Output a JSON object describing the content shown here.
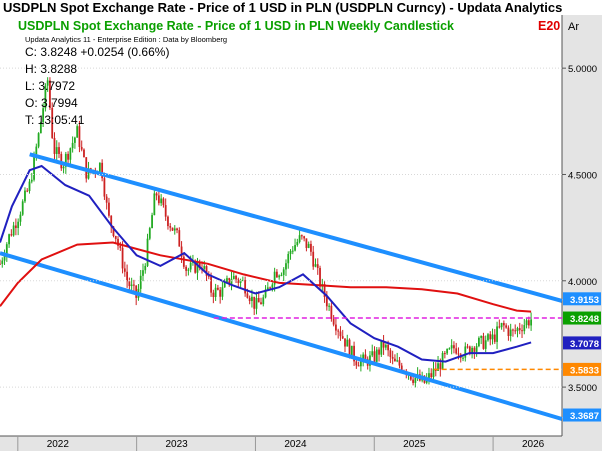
{
  "window": {
    "title": "USDPLN Spot Exchange Rate - Price of 1 USD in PLN (USDPLN Curncy) - Updata Analytics"
  },
  "header": {
    "chart_title": "USDPLN Spot Exchange Rate - Price of 1 USD in PLN Weekly Candlestick",
    "title_suffix": "E20",
    "axis_tag": "Ar",
    "source_line": "Updata Analytics 11 - Enterprise Edition : Data by Bloomberg"
  },
  "info_box": {
    "close": "C: 3.8248  +0.0254 (0.66%)",
    "high": "H: 3.8288",
    "low": "L: 3.7972",
    "open": "O: 3.7994",
    "time": "T: 13:05:41"
  },
  "colors": {
    "title_green": "#0aa000",
    "title_red": "#e00000",
    "channel_blue": "#1e8fff",
    "avg_red": "#e01010",
    "avg_navy": "#2020c0",
    "up_candle": "#22aa22",
    "down_candle": "#cc2222",
    "magenta_line": "#e020e0",
    "orange_line": "#ff8800",
    "axis_bg": "#e4e4e4"
  },
  "chart_data": {
    "type": "candlestick",
    "ylim": [
      3.27,
      5.25
    ],
    "x_range": [
      2021.85,
      2026.58
    ],
    "y_ticks": [
      "5.0000",
      "4.5000",
      "4.0000",
      "3.5000"
    ],
    "x_labels": [
      {
        "label": "2022",
        "x": 2022.0
      },
      {
        "label": "2023",
        "x": 2023.0
      },
      {
        "label": "2024",
        "x": 2024.0
      },
      {
        "label": "2025",
        "x": 2025.0
      },
      {
        "label": "2026",
        "x": 2026.0
      }
    ],
    "price_path": [
      [
        2021.85,
        4.08
      ],
      [
        2021.92,
        4.2
      ],
      [
        2022.0,
        4.3
      ],
      [
        2022.1,
        4.45
      ],
      [
        2022.18,
        4.7
      ],
      [
        2022.25,
        4.95
      ],
      [
        2022.3,
        4.62
      ],
      [
        2022.38,
        4.55
      ],
      [
        2022.5,
        4.7
      ],
      [
        2022.58,
        4.5
      ],
      [
        2022.7,
        4.55
      ],
      [
        2022.76,
        4.3
      ],
      [
        2022.82,
        4.22
      ],
      [
        2022.92,
        4.0
      ],
      [
        2023.0,
        3.92
      ],
      [
        2023.08,
        4.12
      ],
      [
        2023.16,
        4.42
      ],
      [
        2023.25,
        4.3
      ],
      [
        2023.35,
        4.2
      ],
      [
        2023.42,
        4.05
      ],
      [
        2023.55,
        4.08
      ],
      [
        2023.63,
        3.95
      ],
      [
        2023.72,
        3.95
      ],
      [
        2023.8,
        4.02
      ],
      [
        2023.9,
        3.99
      ],
      [
        2024.0,
        3.88
      ],
      [
        2024.08,
        3.92
      ],
      [
        2024.16,
        4.04
      ],
      [
        2024.24,
        4.06
      ],
      [
        2024.3,
        4.15
      ],
      [
        2024.38,
        4.2
      ],
      [
        2024.46,
        4.15
      ],
      [
        2024.56,
        3.96
      ],
      [
        2024.66,
        3.82
      ],
      [
        2024.74,
        3.73
      ],
      [
        2024.84,
        3.63
      ],
      [
        2024.92,
        3.62
      ],
      [
        2025.0,
        3.64
      ],
      [
        2025.08,
        3.7
      ],
      [
        2025.16,
        3.61
      ],
      [
        2025.24,
        3.6
      ],
      [
        2025.32,
        3.55
      ],
      [
        2025.42,
        3.52
      ],
      [
        2025.5,
        3.57
      ],
      [
        2025.58,
        3.63
      ],
      [
        2025.68,
        3.69
      ],
      [
        2025.76,
        3.66
      ],
      [
        2025.84,
        3.7
      ],
      [
        2025.92,
        3.71
      ],
      [
        2026.0,
        3.73
      ],
      [
        2026.08,
        3.79
      ],
      [
        2026.16,
        3.75
      ],
      [
        2026.24,
        3.79
      ],
      [
        2026.32,
        3.82
      ]
    ],
    "series": [
      {
        "name": "",
        "kind": "avg_red",
        "points": [
          [
            2021.85,
            3.88
          ],
          [
            2022.0,
            3.99
          ],
          [
            2022.2,
            4.1
          ],
          [
            2022.5,
            4.17
          ],
          [
            2022.8,
            4.18
          ],
          [
            2023.2,
            4.12
          ],
          [
            2023.6,
            4.08
          ],
          [
            2023.9,
            4.03
          ],
          [
            2024.2,
            3.99
          ],
          [
            2024.5,
            3.98
          ],
          [
            2024.8,
            3.97
          ],
          [
            2025.1,
            3.97
          ],
          [
            2025.4,
            3.96
          ],
          [
            2025.7,
            3.94
          ],
          [
            2026.0,
            3.89
          ],
          [
            2026.2,
            3.86
          ],
          [
            2026.32,
            3.855
          ]
        ]
      },
      {
        "name": "",
        "kind": "avg_navy",
        "points": [
          [
            2021.85,
            4.18
          ],
          [
            2021.95,
            4.35
          ],
          [
            2022.1,
            4.52
          ],
          [
            2022.2,
            4.54
          ],
          [
            2022.4,
            4.45
          ],
          [
            2022.6,
            4.4
          ],
          [
            2022.8,
            4.25
          ],
          [
            2023.0,
            4.12
          ],
          [
            2023.2,
            4.07
          ],
          [
            2023.4,
            4.13
          ],
          [
            2023.6,
            4.03
          ],
          [
            2023.8,
            3.98
          ],
          [
            2024.0,
            3.94
          ],
          [
            2024.2,
            3.97
          ],
          [
            2024.4,
            4.03
          ],
          [
            2024.6,
            3.93
          ],
          [
            2024.8,
            3.8
          ],
          [
            2025.0,
            3.73
          ],
          [
            2025.2,
            3.69
          ],
          [
            2025.4,
            3.63
          ],
          [
            2025.6,
            3.62
          ],
          [
            2025.8,
            3.66
          ],
          [
            2026.0,
            3.66
          ],
          [
            2026.2,
            3.69
          ],
          [
            2026.32,
            3.71
          ]
        ]
      }
    ],
    "channel_lines": [
      {
        "name": "",
        "from": [
          2022.1,
          4.595
        ],
        "to": [
          2026.58,
          3.905
        ]
      },
      {
        "name": "",
        "from": [
          2021.85,
          4.13
        ],
        "to": [
          2026.58,
          3.35
        ]
      }
    ],
    "hlines": [
      {
        "kind": "magenta_line",
        "y": 3.8248,
        "x_from": 2023.65
      },
      {
        "kind": "orange_line",
        "y": 3.5833,
        "x_from": 2025.5
      }
    ],
    "price_labels": [
      {
        "text": "3.9153",
        "y": 3.9153,
        "bg": "#1e8fff",
        "fg": "#ffffff"
      },
      {
        "text": "3.8248",
        "y": 3.8248,
        "bg": "#0aa000",
        "fg": "#ffffff"
      },
      {
        "text": "3.7078",
        "y": 3.7078,
        "bg": "#2020c0",
        "fg": "#ffffff"
      },
      {
        "text": "3.5833",
        "y": 3.5833,
        "bg": "#ff8800",
        "fg": "#ffffff"
      },
      {
        "text": "3.3687",
        "y": 3.3687,
        "bg": "#1e8fff",
        "fg": "#ffffff"
      }
    ]
  }
}
